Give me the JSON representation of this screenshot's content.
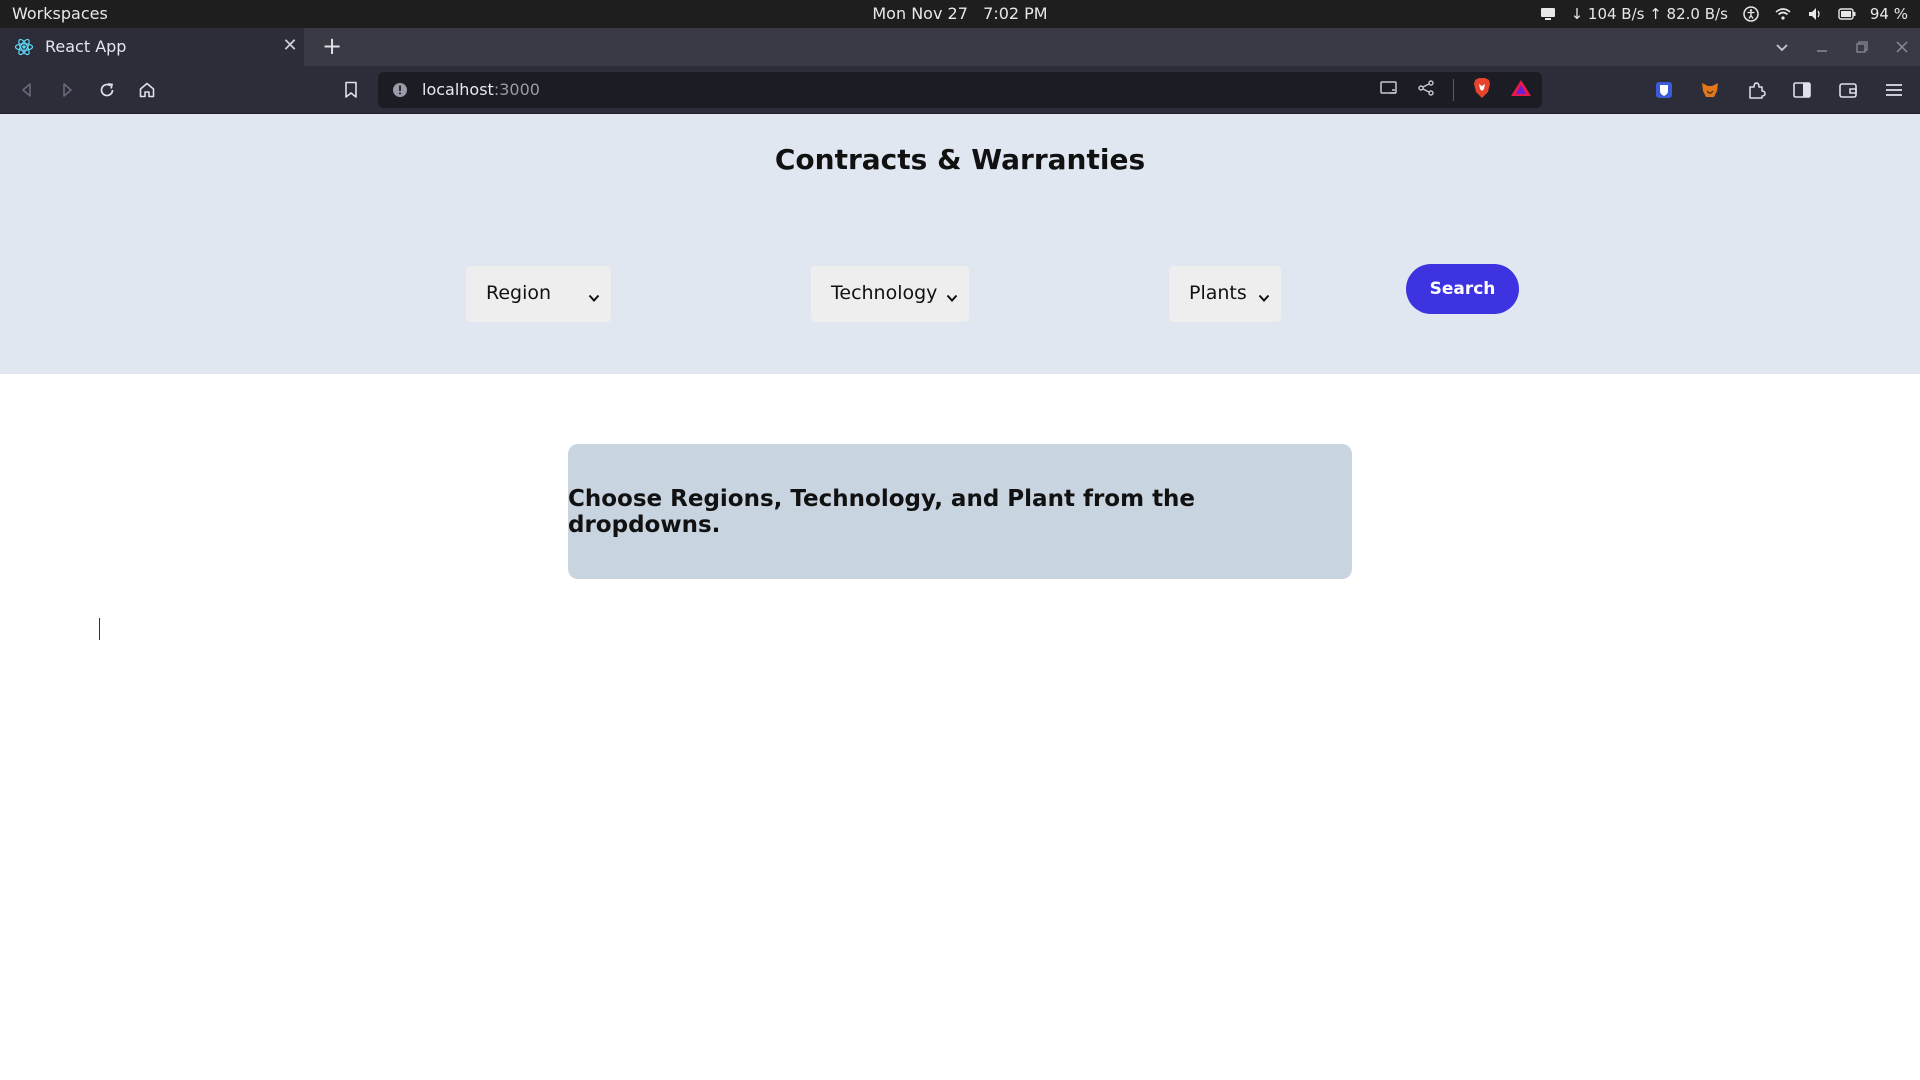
{
  "os_bar": {
    "workspaces": "Workspaces",
    "date": "Mon Nov 27",
    "time": "7:02 PM",
    "network": "↓ 104 B/s ↑ 82.0 B/s",
    "battery": "94 %"
  },
  "browser": {
    "tab": {
      "title": "React App",
      "favicon": "react-icon"
    },
    "url": {
      "host": "localhost",
      "port": ":3000"
    }
  },
  "page": {
    "title": "Contracts & Warranties",
    "filters": {
      "region": {
        "selected": "Region"
      },
      "technology": {
        "selected": "Technology"
      },
      "plants": {
        "selected": "Plants"
      }
    },
    "search_label": "Search",
    "notice": "Choose Regions, Technology, and Plant from the dropdowns."
  },
  "colors": {
    "accent": "#3d33e0",
    "header_band": "#e1e7f1",
    "notice_bg": "#c8d4e0",
    "browser_chrome": "#2d2d39",
    "os_bar": "#1e1e1e"
  }
}
